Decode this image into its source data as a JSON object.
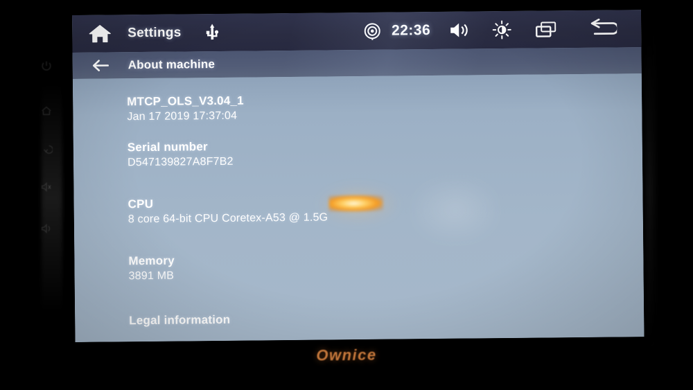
{
  "device": {
    "brand": "Ownice"
  },
  "top_bar": {
    "home_icon": "home-icon",
    "app_title": "Settings",
    "usb_icon": "usb-icon",
    "gps_icon": "gps-location-icon",
    "clock": "22:36",
    "volume_icon": "volume-icon",
    "brightness_icon": "brightness-icon",
    "recents_icon": "recent-apps-icon",
    "back_icon": "back-arrow-icon"
  },
  "sub_bar": {
    "back_icon": "arrow-left-icon",
    "title": "About machine"
  },
  "content": {
    "rows": [
      {
        "name": "build-version",
        "title": "MTCP_OLS_V3.04_1",
        "value": "Jan 17 2019 17:37:04"
      },
      {
        "name": "serial-number",
        "title": "Serial number",
        "value": "D547139827A8F7B2"
      },
      {
        "name": "cpu",
        "title": "CPU",
        "value": "8 core 64-bit CPU Coretex-A53 @ 1.5G"
      },
      {
        "name": "memory",
        "title": "Memory",
        "value": "3891 MB"
      },
      {
        "name": "legal-information",
        "title": "Legal information",
        "value": ""
      }
    ]
  },
  "colors": {
    "top_bar": "#2a2c42",
    "sub_bar": "#525c77",
    "content_bg": "#a3b6c9",
    "text": "#ffffff",
    "brand": "#c2763a",
    "bezel": "#000000"
  }
}
